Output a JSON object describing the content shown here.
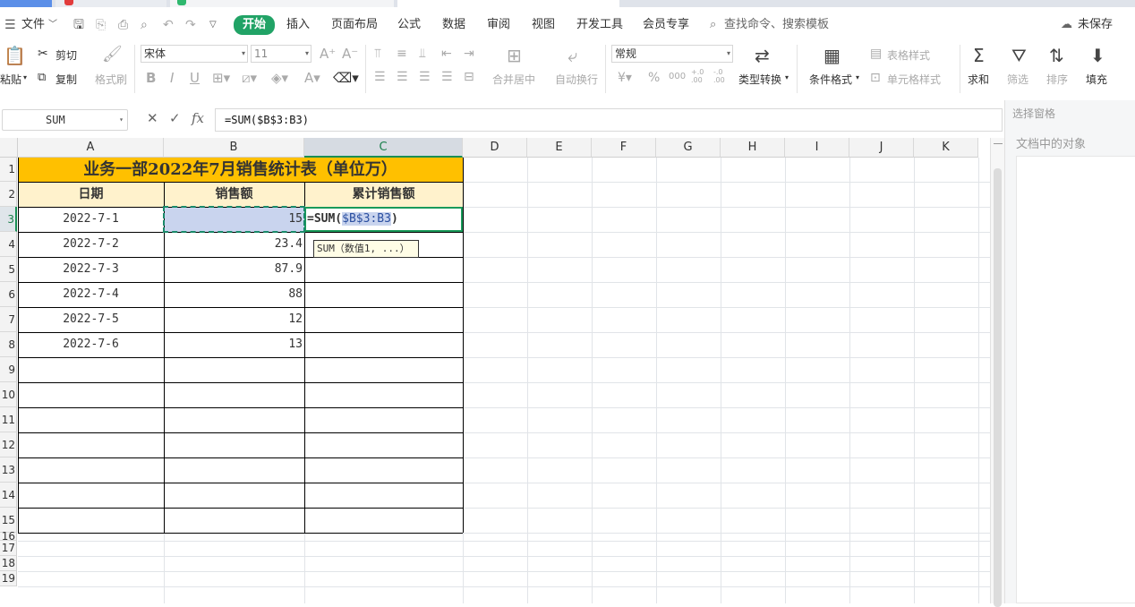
{
  "menubar": {
    "file": "文件",
    "tabs": [
      "开始",
      "插入",
      "页面布局",
      "公式",
      "数据",
      "审阅",
      "视图",
      "开发工具",
      "会员专享"
    ],
    "search": "查找命令、搜索模板",
    "unsaved": "未保存"
  },
  "ribbon": {
    "paste": "粘贴",
    "cut": "剪切",
    "copy": "复制",
    "format_painter": "格式刷",
    "font_name": "宋体",
    "font_size": "11",
    "merge_center": "合并居中",
    "wrap_text": "自动换行",
    "number_format": "常规",
    "type_convert": "类型转换",
    "conditional_format": "条件格式",
    "table_style": "表格样式",
    "cell_style": "单元格样式",
    "sum": "求和",
    "filter": "筛选",
    "sort": "排序",
    "fill": "填充",
    "percent": "%",
    "thousands": "000",
    "dec_inc": "+.0 .00",
    "dec_dec": "-.0 .00"
  },
  "formula_bar": {
    "name_box": "SUM",
    "fx": "fx",
    "formula": "=SUM($B$3:B3)"
  },
  "sidepane": {
    "title": "选择窗格",
    "subtitle": "文档中的对象"
  },
  "sheet": {
    "columns": [
      "A",
      "B",
      "C",
      "D",
      "E",
      "F",
      "G",
      "H",
      "I",
      "J",
      "K"
    ],
    "rows": [
      "1",
      "2",
      "3",
      "4",
      "5",
      "6",
      "7",
      "8",
      "9",
      "10",
      "11",
      "12",
      "13",
      "14",
      "15",
      "16",
      "17",
      "18",
      "19"
    ],
    "title": "业务一部2022年7月销售统计表（单位万）",
    "headers": [
      "日期",
      "销售额",
      "累计销售额"
    ],
    "data": [
      {
        "date": "2022-7-1",
        "amount": "15"
      },
      {
        "date": "2022-7-2",
        "amount": "23.4"
      },
      {
        "date": "2022-7-3",
        "amount": "87.9"
      },
      {
        "date": "2022-7-4",
        "amount": "88"
      },
      {
        "date": "2022-7-5",
        "amount": "12"
      },
      {
        "date": "2022-7-6",
        "amount": "13"
      }
    ],
    "editing_prefix": "=SUM(",
    "editing_ref": "$B$3:B3",
    "editing_suffix": ")",
    "tooltip": "SUM（数值1, ...）"
  },
  "colors": {
    "accent": "#21a366",
    "title_fill": "#ffc000",
    "header_fill": "#fff2cc",
    "ref_highlight": "#c9d4ee"
  }
}
